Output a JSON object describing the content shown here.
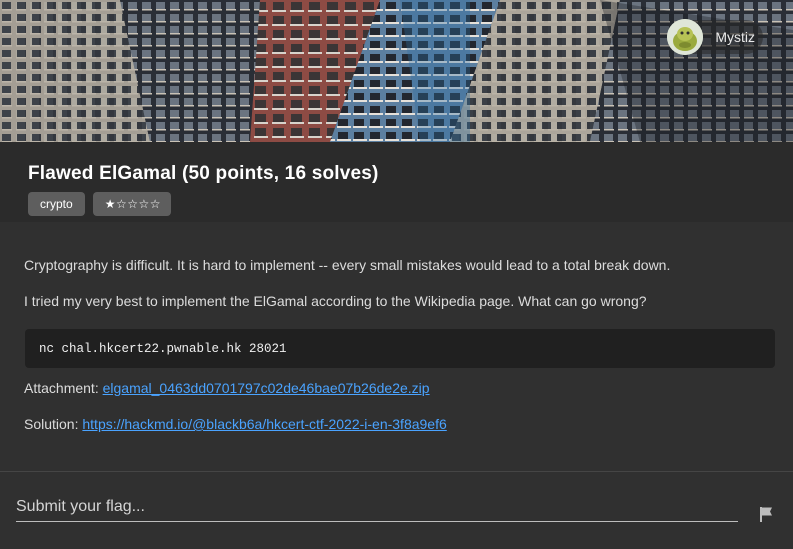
{
  "user": {
    "name": "Mystiz"
  },
  "challenge": {
    "title": "Flawed ElGamal (50 points, 16 solves)",
    "tags": [
      "crypto",
      "★☆☆☆☆"
    ],
    "description": [
      "Cryptography is difficult. It is hard to implement -- every small mistakes would lead to a total break down.",
      "I tried my very best to implement the ElGamal according to the Wikipedia page. What can go wrong?"
    ],
    "command": "nc chal.hkcert22.pwnable.hk 28021",
    "attachment_label": "Attachment:",
    "attachment_link": "elgamal_0463dd0701797c02de46bae07b26de2e.zip",
    "solution_label": "Solution:",
    "solution_link": "https://hackmd.io/@blackb6a/hkcert-ctf-2022-i-en-3f8a9ef6"
  },
  "flag_form": {
    "placeholder": "Submit your flag..."
  },
  "colors": {
    "link": "#4aa3ff",
    "background": "#303030"
  }
}
